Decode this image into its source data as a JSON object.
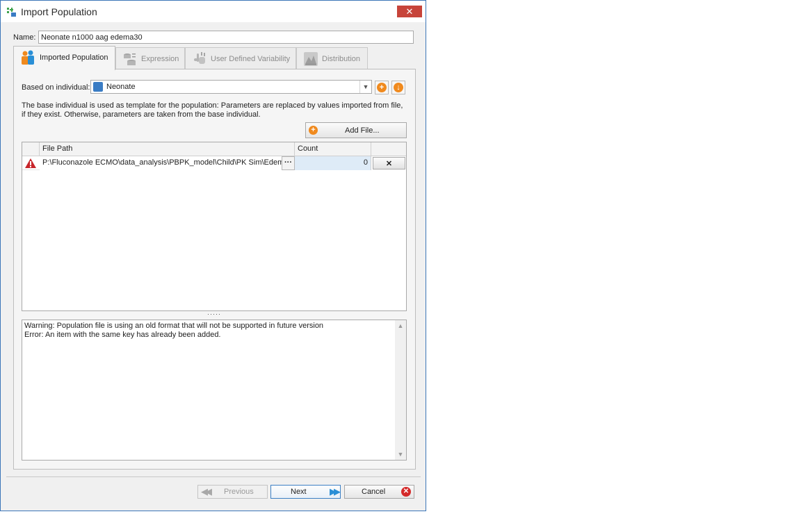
{
  "window": {
    "title": "Import Population",
    "close_glyph": "✕"
  },
  "name_field": {
    "label": "Name:",
    "value": "Neonate n1000 aag edema30"
  },
  "tabs": [
    {
      "label": "Imported Population",
      "icon": "population-icon",
      "active": true
    },
    {
      "label": "Expression",
      "icon": "expression-icon",
      "active": false
    },
    {
      "label": "User Defined Variability",
      "icon": "variability-icon",
      "active": false
    },
    {
      "label": "Distribution",
      "icon": "distribution-icon",
      "active": false
    }
  ],
  "individual": {
    "label": "Based on individual:",
    "selected": "Neonate"
  },
  "description": "The base individual is used as template for the population: Parameters are replaced by values imported from file, if they exist. Otherwise, parameters are taken from the base individual.",
  "add_file_label": "Add File...",
  "grid": {
    "columns": [
      "File Path",
      "Count"
    ],
    "rows": [
      {
        "status": "warning-icon",
        "path": "P:\\Fluconazole ECMO\\data_analysis\\PBPK_model\\Child\\PK Sim\\Edem...",
        "ellipsis": "···",
        "count": "0",
        "delete": "✕"
      }
    ]
  },
  "splitter_dots": "·····",
  "log": {
    "lines": [
      "Warning: Population file is using an old format that will not be supported in future version",
      "Error: An item with the same key has already been added."
    ]
  },
  "footer": {
    "previous": "Previous",
    "next": "Next",
    "cancel": "Cancel"
  },
  "colors": {
    "accent_orange": "#f08a1e",
    "close_red": "#c7443a",
    "selected_row": "#deebf7",
    "window_border": "#3c76b8"
  }
}
